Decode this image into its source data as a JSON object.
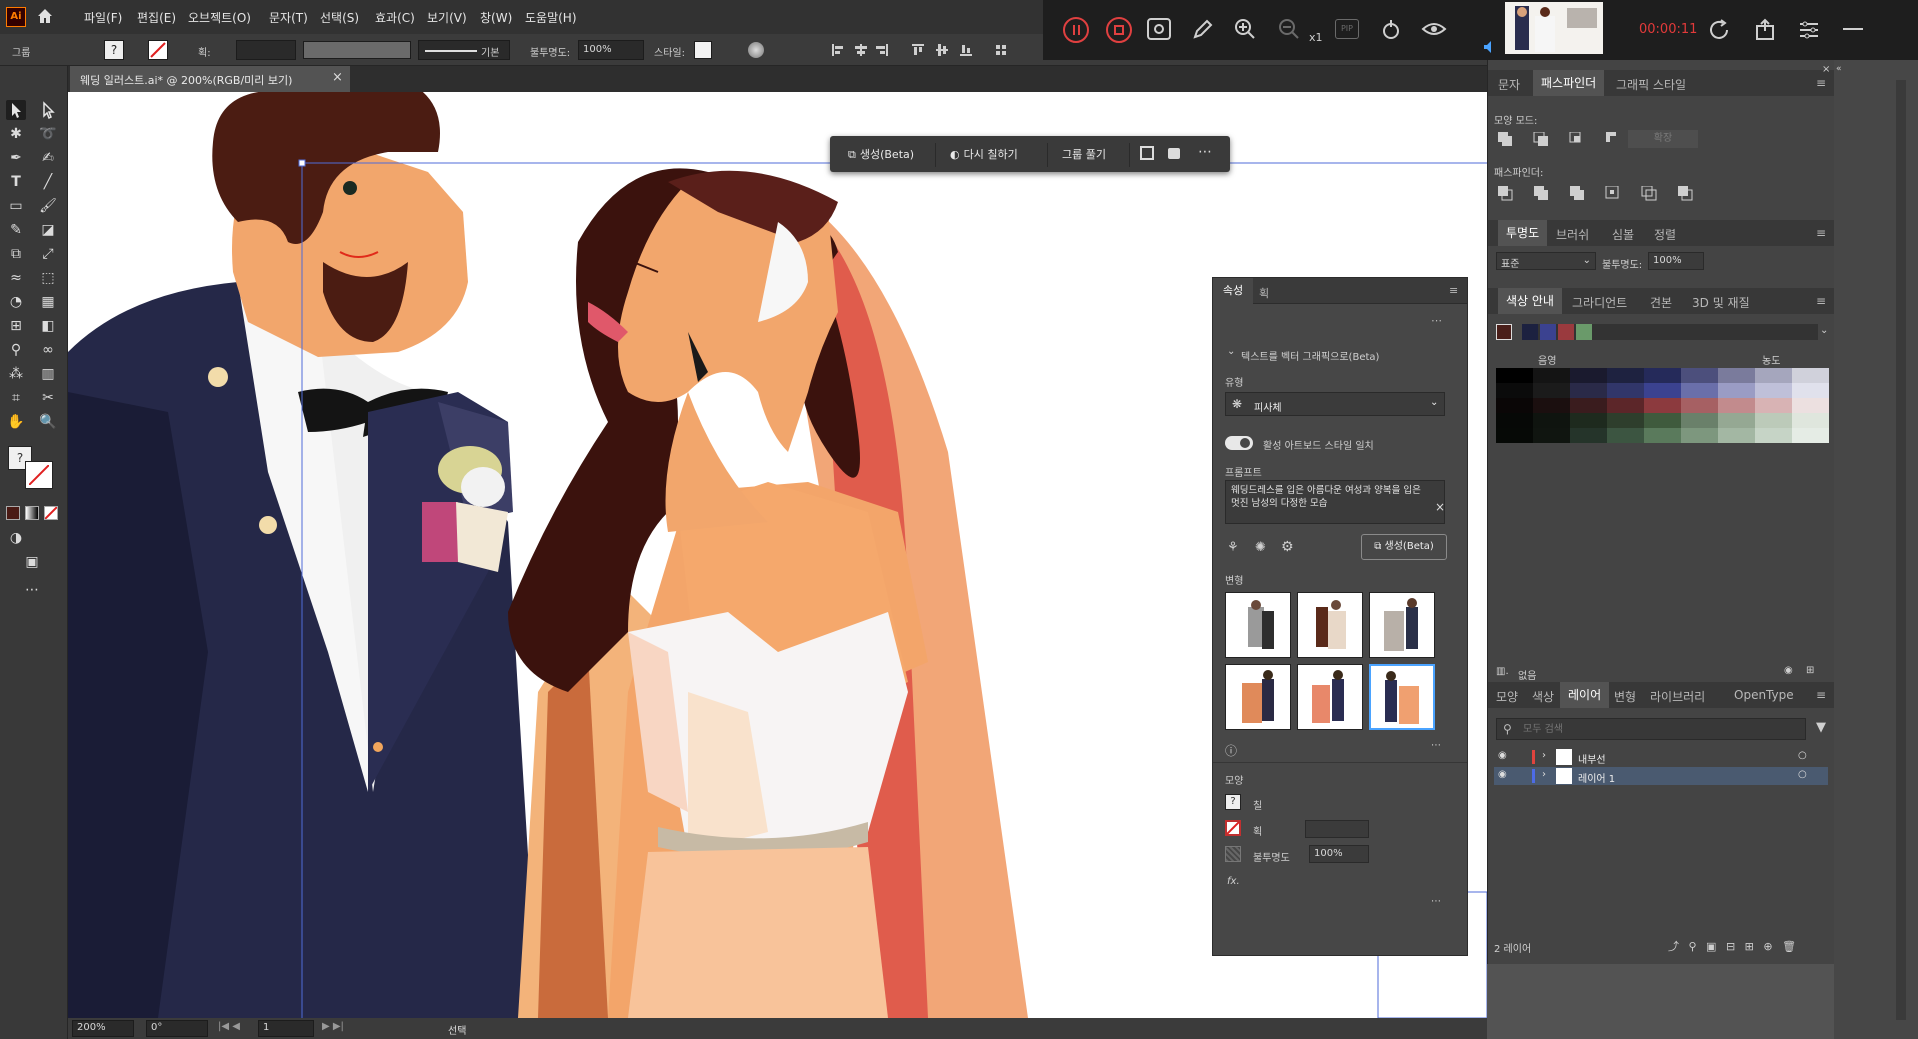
{
  "app": {
    "logo": "Ai",
    "home_icon": "home-icon"
  },
  "menu": [
    "파일(F)",
    "편집(E)",
    "오브젝트(O)",
    "문자(T)",
    "선택(S)",
    "효과(C)",
    "보기(V)",
    "창(W)",
    "도움말(H)"
  ],
  "control": {
    "selection_label": "그룹",
    "stroke_label": "획:",
    "stroke_style": "기본",
    "opacity_label": "불투명도:",
    "opacity_value": "100%",
    "style_label": "스타일:"
  },
  "recorder": {
    "timer": "00:00:11",
    "zoom_multiplier": "x1",
    "pip_label": "PIP",
    "timer_color": "#e23a3a"
  },
  "document": {
    "tab_title": "웨딩 일러스트.ai* @ 200%(RGB/미리 보기)",
    "close": "×"
  },
  "floating_bar": {
    "generate": "생성(Beta)",
    "recolor": "다시 칠하기",
    "ungroup": "그룹 풀기"
  },
  "status": {
    "zoom": "200%",
    "rotation": "0°",
    "artboard": "1",
    "tool": "선택"
  },
  "properties": {
    "tabs": [
      "속성",
      "획"
    ],
    "section_title": "텍스트를 벡터 그래픽으로(Beta)",
    "type_label": "유형",
    "type_value": "피사체",
    "toggle_label": "활성 아트보드 스타일 일치",
    "prompt_label": "프롬프트",
    "prompt_text": "웨딩드레스를 입은 아름다운 여성과 양복을 입은 멋진 남성의 다정한 모습",
    "generate_button": "생성(Beta)",
    "variations_label": "변형",
    "appearance_label": "모양",
    "fill_label": "칠",
    "stroke_label": "획",
    "opacity_label": "불투명도",
    "opacity_value": "100%",
    "fx_label": "fx."
  },
  "panels": {
    "top_tabs": [
      "문자",
      "패스파인더",
      "그래픽 스타일"
    ],
    "shape_modes_label": "모양 모드:",
    "expand_button": "확장",
    "pathfinders_label": "패스파인더:",
    "transparency_tabs": [
      "투명도",
      "브러쉬",
      "심볼",
      "정렬"
    ],
    "blend_mode": "표준",
    "opacity_label": "불투명도:",
    "opacity_value": "100%",
    "color_guide_tabs": [
      "색상 안내",
      "그라디언트",
      "견본",
      "3D 및 재질"
    ],
    "shade_label": "음영",
    "tint_label": "농도",
    "none_label": "없음",
    "layers_tabs": [
      "모양",
      "색상",
      "레이어",
      "변형",
      "라이브러리",
      "OpenType"
    ],
    "search_placeholder": "모두 검색",
    "layers": [
      {
        "name": "내부선",
        "color": "#e0443e"
      },
      {
        "name": "레이어 1",
        "color": "#4d6be6"
      }
    ],
    "layer_count": "2 레이어"
  },
  "colors": {
    "swatch_rows": [
      [
        "#000000",
        "#141414",
        "#1a1a2e",
        "#1e2240",
        "#252a5a",
        "#4c4f7c",
        "#7a7b9c",
        "#a5a6bd",
        "#d0d1db"
      ],
      [
        "#0b0b0b",
        "#1b1b1b",
        "#2a2a48",
        "#31366a",
        "#3b4290",
        "#6a6faa",
        "#9a9cc4",
        "#bfc0d9",
        "#e0e1ec"
      ],
      [
        "#0a0606",
        "#1b0f0f",
        "#3a1c1e",
        "#5c2629",
        "#8c3a3e",
        "#a66063",
        "#c28b8d",
        "#d8b3b4",
        "#ece0e0"
      ],
      [
        "#060806",
        "#0f140f",
        "#1e2a1e",
        "#2e3e2c",
        "#3f5a3d",
        "#6a806a",
        "#95a893",
        "#bccab9",
        "#dfe6dd"
      ],
      [
        "#060906",
        "#101510",
        "#25342a",
        "#3c5541",
        "#5a7a5c",
        "#7d977e",
        "#a3b7a3",
        "#c6d4c6",
        "#e5ece5"
      ]
    ],
    "guide": [
      "#4a1f1a",
      "#1c2140",
      "#3b4290",
      "#9a3a3e",
      "#6a9a6a"
    ]
  }
}
